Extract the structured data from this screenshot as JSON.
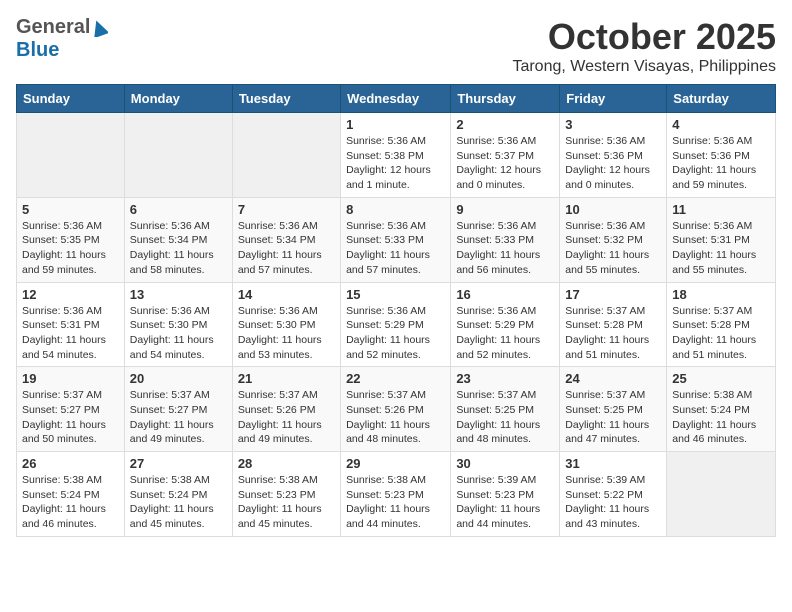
{
  "logo": {
    "general": "General",
    "blue": "Blue"
  },
  "title": "October 2025",
  "location": "Tarong, Western Visayas, Philippines",
  "weekdays": [
    "Sunday",
    "Monday",
    "Tuesday",
    "Wednesday",
    "Thursday",
    "Friday",
    "Saturday"
  ],
  "weeks": [
    [
      {
        "day": "",
        "info": ""
      },
      {
        "day": "",
        "info": ""
      },
      {
        "day": "",
        "info": ""
      },
      {
        "day": "1",
        "info": "Sunrise: 5:36 AM\nSunset: 5:38 PM\nDaylight: 12 hours\nand 1 minute."
      },
      {
        "day": "2",
        "info": "Sunrise: 5:36 AM\nSunset: 5:37 PM\nDaylight: 12 hours\nand 0 minutes."
      },
      {
        "day": "3",
        "info": "Sunrise: 5:36 AM\nSunset: 5:36 PM\nDaylight: 12 hours\nand 0 minutes."
      },
      {
        "day": "4",
        "info": "Sunrise: 5:36 AM\nSunset: 5:36 PM\nDaylight: 11 hours\nand 59 minutes."
      }
    ],
    [
      {
        "day": "5",
        "info": "Sunrise: 5:36 AM\nSunset: 5:35 PM\nDaylight: 11 hours\nand 59 minutes."
      },
      {
        "day": "6",
        "info": "Sunrise: 5:36 AM\nSunset: 5:34 PM\nDaylight: 11 hours\nand 58 minutes."
      },
      {
        "day": "7",
        "info": "Sunrise: 5:36 AM\nSunset: 5:34 PM\nDaylight: 11 hours\nand 57 minutes."
      },
      {
        "day": "8",
        "info": "Sunrise: 5:36 AM\nSunset: 5:33 PM\nDaylight: 11 hours\nand 57 minutes."
      },
      {
        "day": "9",
        "info": "Sunrise: 5:36 AM\nSunset: 5:33 PM\nDaylight: 11 hours\nand 56 minutes."
      },
      {
        "day": "10",
        "info": "Sunrise: 5:36 AM\nSunset: 5:32 PM\nDaylight: 11 hours\nand 55 minutes."
      },
      {
        "day": "11",
        "info": "Sunrise: 5:36 AM\nSunset: 5:31 PM\nDaylight: 11 hours\nand 55 minutes."
      }
    ],
    [
      {
        "day": "12",
        "info": "Sunrise: 5:36 AM\nSunset: 5:31 PM\nDaylight: 11 hours\nand 54 minutes."
      },
      {
        "day": "13",
        "info": "Sunrise: 5:36 AM\nSunset: 5:30 PM\nDaylight: 11 hours\nand 54 minutes."
      },
      {
        "day": "14",
        "info": "Sunrise: 5:36 AM\nSunset: 5:30 PM\nDaylight: 11 hours\nand 53 minutes."
      },
      {
        "day": "15",
        "info": "Sunrise: 5:36 AM\nSunset: 5:29 PM\nDaylight: 11 hours\nand 52 minutes."
      },
      {
        "day": "16",
        "info": "Sunrise: 5:36 AM\nSunset: 5:29 PM\nDaylight: 11 hours\nand 52 minutes."
      },
      {
        "day": "17",
        "info": "Sunrise: 5:37 AM\nSunset: 5:28 PM\nDaylight: 11 hours\nand 51 minutes."
      },
      {
        "day": "18",
        "info": "Sunrise: 5:37 AM\nSunset: 5:28 PM\nDaylight: 11 hours\nand 51 minutes."
      }
    ],
    [
      {
        "day": "19",
        "info": "Sunrise: 5:37 AM\nSunset: 5:27 PM\nDaylight: 11 hours\nand 50 minutes."
      },
      {
        "day": "20",
        "info": "Sunrise: 5:37 AM\nSunset: 5:27 PM\nDaylight: 11 hours\nand 49 minutes."
      },
      {
        "day": "21",
        "info": "Sunrise: 5:37 AM\nSunset: 5:26 PM\nDaylight: 11 hours\nand 49 minutes."
      },
      {
        "day": "22",
        "info": "Sunrise: 5:37 AM\nSunset: 5:26 PM\nDaylight: 11 hours\nand 48 minutes."
      },
      {
        "day": "23",
        "info": "Sunrise: 5:37 AM\nSunset: 5:25 PM\nDaylight: 11 hours\nand 48 minutes."
      },
      {
        "day": "24",
        "info": "Sunrise: 5:37 AM\nSunset: 5:25 PM\nDaylight: 11 hours\nand 47 minutes."
      },
      {
        "day": "25",
        "info": "Sunrise: 5:38 AM\nSunset: 5:24 PM\nDaylight: 11 hours\nand 46 minutes."
      }
    ],
    [
      {
        "day": "26",
        "info": "Sunrise: 5:38 AM\nSunset: 5:24 PM\nDaylight: 11 hours\nand 46 minutes."
      },
      {
        "day": "27",
        "info": "Sunrise: 5:38 AM\nSunset: 5:24 PM\nDaylight: 11 hours\nand 45 minutes."
      },
      {
        "day": "28",
        "info": "Sunrise: 5:38 AM\nSunset: 5:23 PM\nDaylight: 11 hours\nand 45 minutes."
      },
      {
        "day": "29",
        "info": "Sunrise: 5:38 AM\nSunset: 5:23 PM\nDaylight: 11 hours\nand 44 minutes."
      },
      {
        "day": "30",
        "info": "Sunrise: 5:39 AM\nSunset: 5:23 PM\nDaylight: 11 hours\nand 44 minutes."
      },
      {
        "day": "31",
        "info": "Sunrise: 5:39 AM\nSunset: 5:22 PM\nDaylight: 11 hours\nand 43 minutes."
      },
      {
        "day": "",
        "info": ""
      }
    ]
  ]
}
